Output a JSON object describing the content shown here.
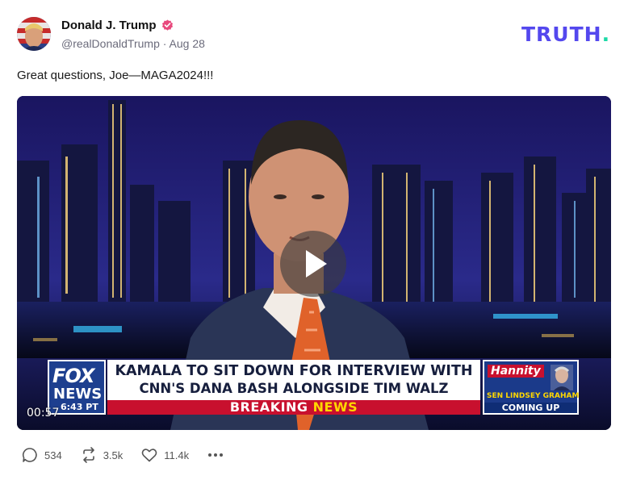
{
  "author": {
    "display_name": "Donald J. Trump",
    "handle": "@realDonaldTrump",
    "separator": "·",
    "date": "Aug 28",
    "verified_icon": "verified-badge-icon"
  },
  "brand": {
    "logo_main": "TRUTH",
    "logo_dot": ".",
    "accent": "#5448ee",
    "dot_color": "#1bd9a6"
  },
  "post": {
    "text": "Great questions, Joe—MAGA2024!!!"
  },
  "video": {
    "timestamp": "00:57",
    "play_icon": "play-icon",
    "chyron": {
      "network_line1": "FOX",
      "network_line2": "NEWS",
      "clock": "6:43 PT",
      "headline_line1": "KAMALA TO SIT DOWN FOR INTERVIEW WITH",
      "headline_line2": "CNN'S DANA BASH ALONGSIDE TIM WALZ THURSDAY",
      "breaking_word1": "BREAKING",
      "breaking_word2": "NEWS",
      "show_name": "Hannity",
      "guest": "SEN LINDSEY GRAHAM",
      "coming_up": "COMING UP"
    }
  },
  "actions": {
    "replies": "534",
    "retruths": "3.5k",
    "likes": "11.4k",
    "more_icon": "more-icon"
  }
}
